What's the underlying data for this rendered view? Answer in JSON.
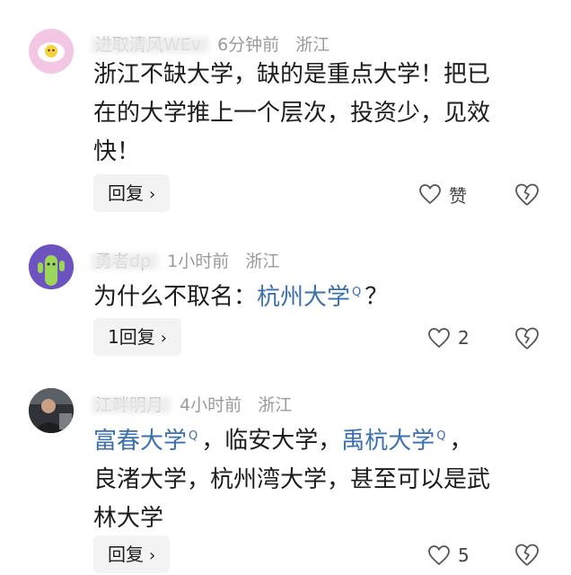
{
  "comments": [
    {
      "username": "进取清风WEv",
      "time": "6分钟前",
      "location": "浙江",
      "text": "浙江不缺大学，缺的是重点大学！把已在的大学推上一个层次，投资少，见效快！",
      "lines": [
        "浙江不缺大学，缺的是重点大学！把已",
        "在的大学推上一个层次，投资少，见效",
        "快！"
      ],
      "reply_label": "回复",
      "like_label": "赞"
    },
    {
      "username": "勇者dp",
      "time": "1小时前",
      "location": "浙江",
      "text_prefix": "为什么不取名：",
      "text_link": "杭州大学",
      "text_suffix": "？",
      "reply_label": "1回复",
      "like_label": "2"
    },
    {
      "username": "江畔明月",
      "time": "4小时前",
      "location": "浙江",
      "line1_link1": "富春大学",
      "line1_mid": "，临安大学，",
      "line1_link2": "禹杭大学",
      "line1_end": "，",
      "line2": "良渚大学，杭州湾大学，甚至可以是武",
      "line3": "林大学",
      "reply_label": "回复",
      "like_label": "5"
    }
  ],
  "chevron": "›",
  "search_mark": "Q"
}
